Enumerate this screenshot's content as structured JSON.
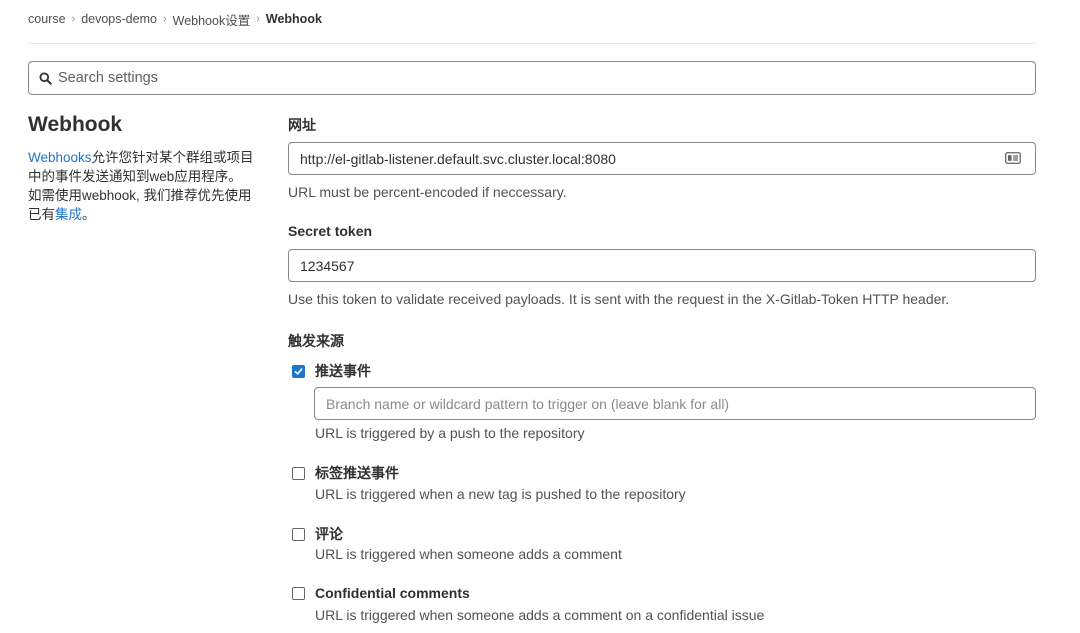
{
  "breadcrumb": [
    {
      "label": "course"
    },
    {
      "label": "devops-demo"
    },
    {
      "label": "Webhook设置"
    },
    {
      "label": "Webhook"
    }
  ],
  "search": {
    "placeholder": "Search settings",
    "icon": "search-icon"
  },
  "sidebar": {
    "title": "Webhook",
    "desc_link": "Webhooks",
    "desc_text": "允许您针对某个群组或项目中的事件发送通知到web应用程序。 如需使用webhook, 我们推荐优先使用已有",
    "desc_link2": "集成",
    "desc_end": "。"
  },
  "form": {
    "url_label": "网址",
    "url_value": "http://el-gitlab-listener.default.svc.cluster.local:8080",
    "url_help": "URL must be percent-encoded if neccessary.",
    "token_label": "Secret token",
    "token_value": "1234567",
    "token_help": "Use this token to validate received payloads. It is sent with the request in the X-Gitlab-Token HTTP header.",
    "triggers_label": "触发来源",
    "triggers": [
      {
        "label": "推送事件",
        "checked": true,
        "help": "URL is triggered by a push to the repository",
        "input_placeholder": "Branch name or wildcard pattern to trigger on (leave blank for all)"
      },
      {
        "label": "标签推送事件",
        "checked": false,
        "help": "URL is triggered when a new tag is pushed to the repository"
      },
      {
        "label": "评论",
        "checked": false,
        "help": "URL is triggered when someone adds a comment"
      },
      {
        "label": "Confidential comments",
        "checked": false,
        "help": "URL is triggered when someone adds a comment on a confidential issue"
      }
    ]
  },
  "colors": {
    "link": "#1f75cb",
    "checkbox_checked": "#1f75cb"
  }
}
